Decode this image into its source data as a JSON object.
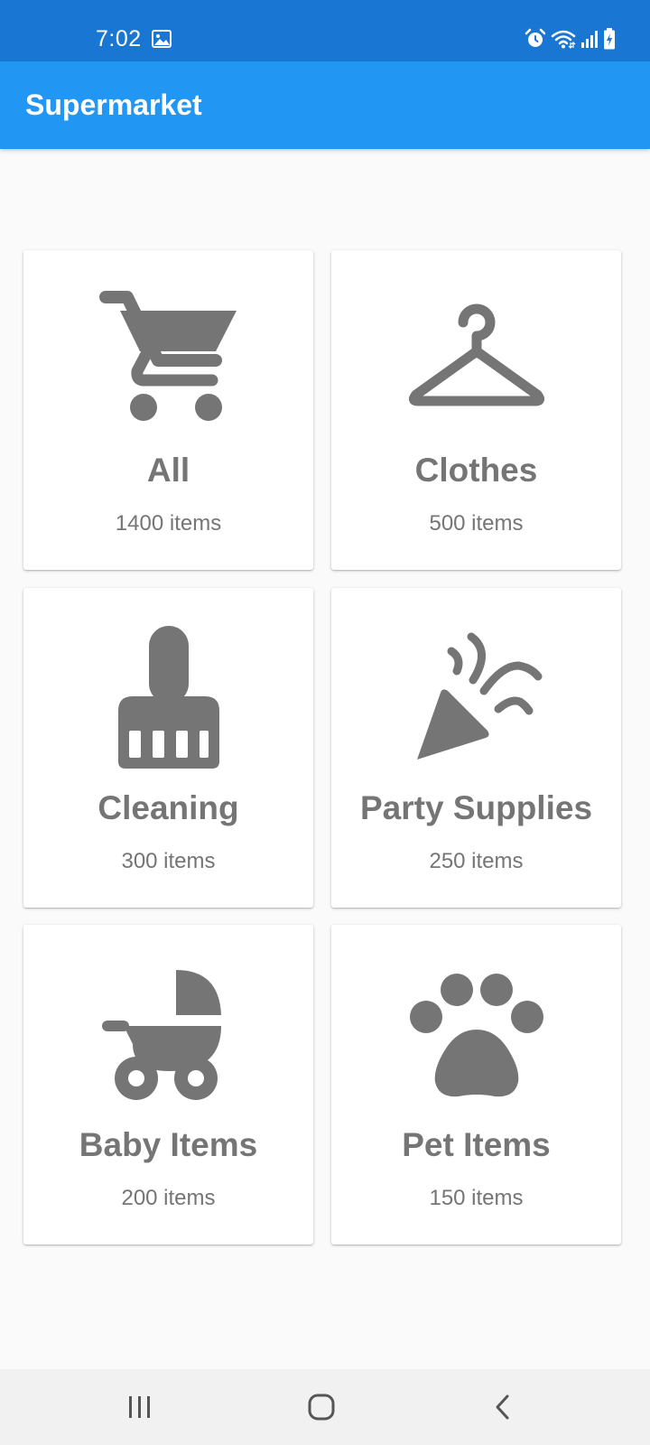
{
  "status_bar": {
    "time": "7:02",
    "icons": [
      "photo-icon",
      "alarm-icon",
      "wifi-icon",
      "signal-icon",
      "battery-charging-icon"
    ]
  },
  "app_bar": {
    "title": "Supermarket"
  },
  "categories": [
    {
      "name": "All",
      "count": "1400 items",
      "icon": "shopping-cart-icon"
    },
    {
      "name": "Clothes",
      "count": "500 items",
      "icon": "hanger-icon"
    },
    {
      "name": "Cleaning",
      "count": "300 items",
      "icon": "cleaning-brush-icon"
    },
    {
      "name": "Party Supplies",
      "count": "250 items",
      "icon": "party-popper-icon"
    },
    {
      "name": "Baby Items",
      "count": "200 items",
      "icon": "stroller-icon"
    },
    {
      "name": "Pet Items",
      "count": "150 items",
      "icon": "paw-icon"
    }
  ],
  "nav_bar": {
    "buttons": [
      "recent-apps-icon",
      "home-icon",
      "back-icon"
    ]
  },
  "colors": {
    "status_bar": "#1976d2",
    "app_bar": "#2196f3",
    "background": "#fafafa",
    "card": "#ffffff",
    "icon_and_text": "#757575",
    "nav_bar": "#f1f1f1"
  }
}
